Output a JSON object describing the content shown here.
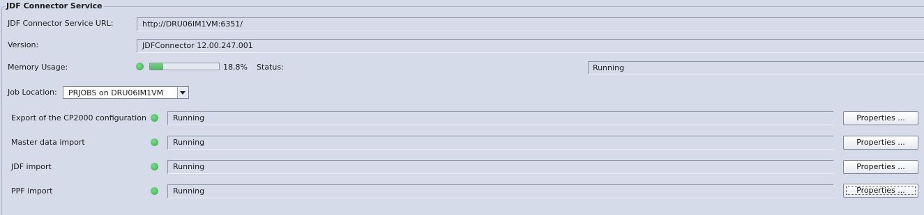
{
  "group_title": "JDF Connector Service",
  "service_url": {
    "label": "JDF Connector Service URL:",
    "value": "http://DRU06IM1VM:6351/"
  },
  "version": {
    "label": "Version:",
    "value": "JDFConnector 12.00.247.001"
  },
  "memory": {
    "label": "Memory Usage:",
    "percent_text": "18.8%",
    "fraction": 0.188,
    "indicator_color": "#56c26a"
  },
  "status": {
    "label": "Status:",
    "value": "Running"
  },
  "job_location": {
    "label": "Job Location:",
    "selected": "PRJOBS on DRU06IM1VM"
  },
  "services": [
    {
      "name": "Export of the CP2000 configuration",
      "status": "Running",
      "button": "Properties ..."
    },
    {
      "name": "Master data import",
      "status": "Running",
      "button": "Properties ..."
    },
    {
      "name": "JDF import",
      "status": "Running",
      "button": "Properties ..."
    },
    {
      "name": "PPF import",
      "status": "Running",
      "button": "Properties ..."
    }
  ]
}
